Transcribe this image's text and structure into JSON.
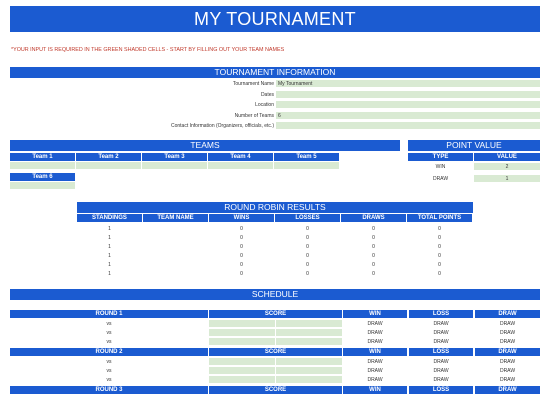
{
  "title": "MY TOURNAMENT",
  "instruction": "*YOUR INPUT IS REQUIRED IN THE GREEN SHADED CELLS - START BY FILLING OUT YOUR TEAM NAMES",
  "info": {
    "header": "TOURNAMENT INFORMATION",
    "rows": [
      {
        "label": "Tournament Name",
        "value": "My Tournament"
      },
      {
        "label": "Dates",
        "value": ""
      },
      {
        "label": "Location",
        "value": ""
      },
      {
        "label": "Number of Teams",
        "value": "6"
      },
      {
        "label": "Contact Information (Organizers, officials, etc.)",
        "value": ""
      }
    ]
  },
  "teams": {
    "header": "TEAMS",
    "row1": [
      "Team 1",
      "Team 2",
      "Team 3",
      "Team 4",
      "Team 5"
    ],
    "row2": [
      "Team 6"
    ]
  },
  "points": {
    "header": "POINT VALUE",
    "col_type": "TYPE",
    "col_value": "VALUE",
    "rows": [
      {
        "type": "WIN",
        "value": "2"
      },
      {
        "type": "DRAW",
        "value": "1"
      }
    ]
  },
  "robin": {
    "header": "ROUND ROBIN RESULTS",
    "columns": [
      "STANDINGS",
      "TEAM NAME",
      "WINS",
      "LOSSES",
      "DRAWS",
      "TOTAL POINTS"
    ],
    "rows": [
      [
        "1",
        "",
        "0",
        "0",
        "0",
        "0"
      ],
      [
        "1",
        "",
        "0",
        "0",
        "0",
        "0"
      ],
      [
        "1",
        "",
        "0",
        "0",
        "0",
        "0"
      ],
      [
        "1",
        "",
        "0",
        "0",
        "0",
        "0"
      ],
      [
        "1",
        "",
        "0",
        "0",
        "0",
        "0"
      ],
      [
        "1",
        "",
        "0",
        "0",
        "0",
        "0"
      ]
    ]
  },
  "schedule": {
    "header": "SCHEDULE",
    "score_label": "SCORE",
    "win_label": "WIN",
    "loss_label": "LOSS",
    "draw_label": "DRAW",
    "vs_label": "vs",
    "rounds": [
      {
        "label": "ROUND 1",
        "matches": 3
      },
      {
        "label": "ROUND 2",
        "matches": 3
      },
      {
        "label": "ROUND 3",
        "matches": 0
      }
    ]
  },
  "colors": {
    "header_blue": "#1b5bd1",
    "input_green": "#d9ead3",
    "instruction_red": "#c0392b"
  }
}
